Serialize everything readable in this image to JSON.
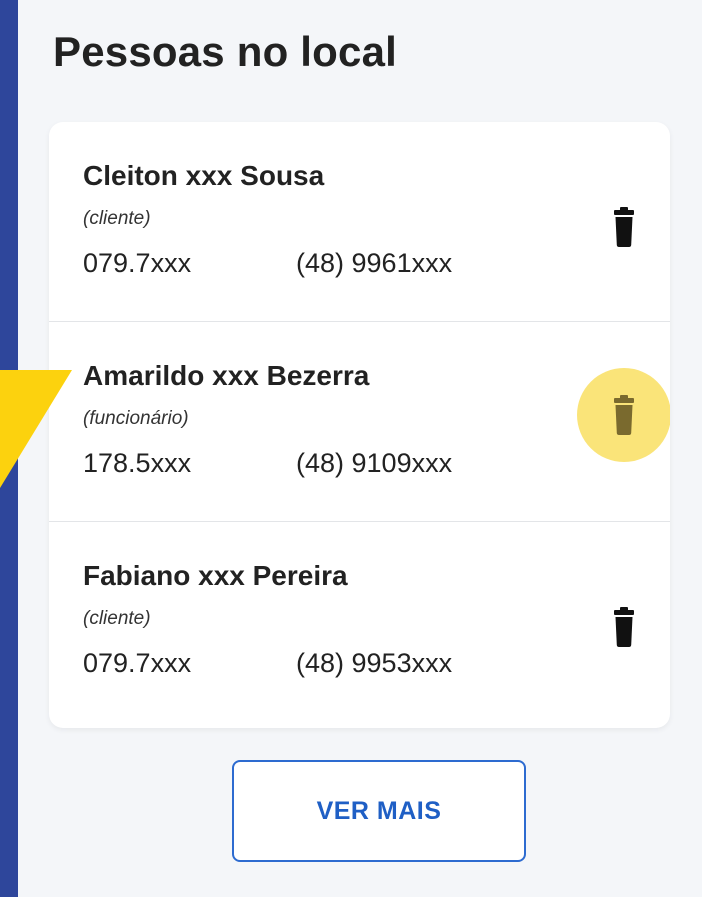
{
  "page": {
    "title": "Pessoas no local"
  },
  "people": [
    {
      "name": "Cleiton xxx Sousa",
      "role": "(cliente)",
      "document": "079.7xxx",
      "phone": "(48) 9961xxx"
    },
    {
      "name": "Amarildo xxx Bezerra",
      "role": "(funcionário)",
      "document": "178.5xxx",
      "phone": "(48) 9109xxx"
    },
    {
      "name": "Fabiano xxx Pereira",
      "role": "(cliente)",
      "document": "079.7xxx",
      "phone": "(48) 9953xxx"
    }
  ],
  "actions": {
    "delete_icon": "trash-icon",
    "more_label": "VER MAIS"
  },
  "colors": {
    "frame_blue": "#2e469b",
    "panel_background": "#f4f6f9",
    "highlight_yellow": "#fae479",
    "pointer_yellow": "#fcd20e",
    "accent_blue": "#1f5fc5"
  }
}
